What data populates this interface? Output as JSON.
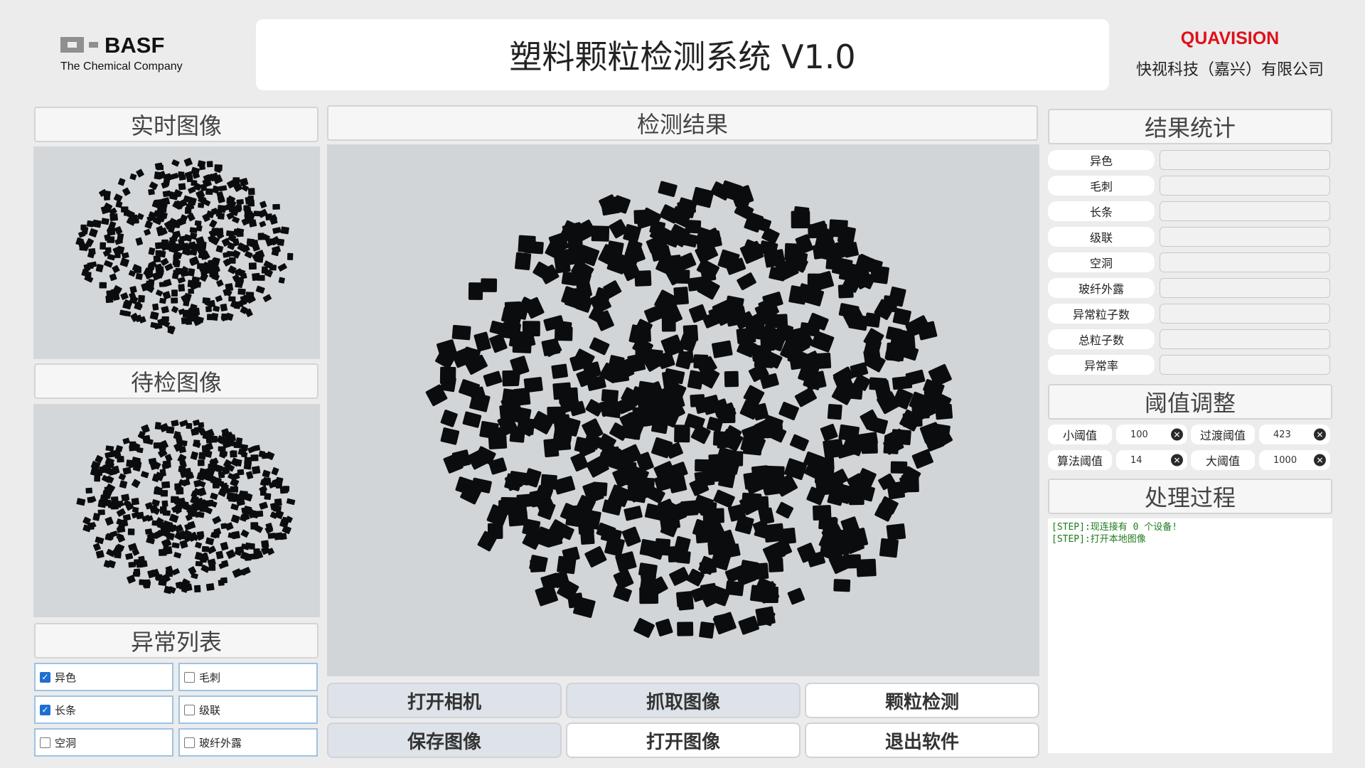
{
  "header": {
    "logo_text": "BASF",
    "logo_tagline": "The Chemical Company",
    "title": "塑料颗粒检测系统 V1.0",
    "brand": "QUAVISION",
    "company": "快视科技（嘉兴）有限公司"
  },
  "left": {
    "realtime_title": "实时图像",
    "pending_title": "待检图像",
    "anomaly_title": "异常列表",
    "anomalies": [
      {
        "label": "异色",
        "checked": true
      },
      {
        "label": "毛刺",
        "checked": false
      },
      {
        "label": "长条",
        "checked": true
      },
      {
        "label": "级联",
        "checked": false
      },
      {
        "label": "空洞",
        "checked": false
      },
      {
        "label": "玻纤外露",
        "checked": false
      }
    ]
  },
  "center": {
    "result_title": "检测结果",
    "buttons": [
      "打开相机",
      "抓取图像",
      "颗粒检测",
      "保存图像",
      "打开图像",
      "退出软件"
    ]
  },
  "right": {
    "stats_title": "结果统计",
    "stats": [
      {
        "label": "异色",
        "value": ""
      },
      {
        "label": "毛刺",
        "value": ""
      },
      {
        "label": "长条",
        "value": ""
      },
      {
        "label": "级联",
        "value": ""
      },
      {
        "label": "空洞",
        "value": ""
      },
      {
        "label": "玻纤外露",
        "value": ""
      },
      {
        "label": "异常粒子数",
        "value": ""
      },
      {
        "label": "总粒子数",
        "value": ""
      },
      {
        "label": "异常率",
        "value": ""
      }
    ],
    "threshold_title": "阈值调整",
    "thresholds": [
      {
        "label": "小阈值",
        "value": "100"
      },
      {
        "label": "过渡阈值",
        "value": "423"
      },
      {
        "label": "算法阈值",
        "value": "14"
      },
      {
        "label": "大阈值",
        "value": "1000"
      }
    ],
    "process_title": "处理过程",
    "log": [
      "[STEP]:现连接有 0 个设备!",
      "[STEP]:打开本地图像"
    ]
  },
  "colors": {
    "brand_red": "#e0101a",
    "check_blue": "#1f6fd0",
    "log_green": "#1f7a1f",
    "background": "#ececec"
  },
  "icons": {
    "clear": "clear-circle-icon",
    "check": "checkmark-icon"
  }
}
